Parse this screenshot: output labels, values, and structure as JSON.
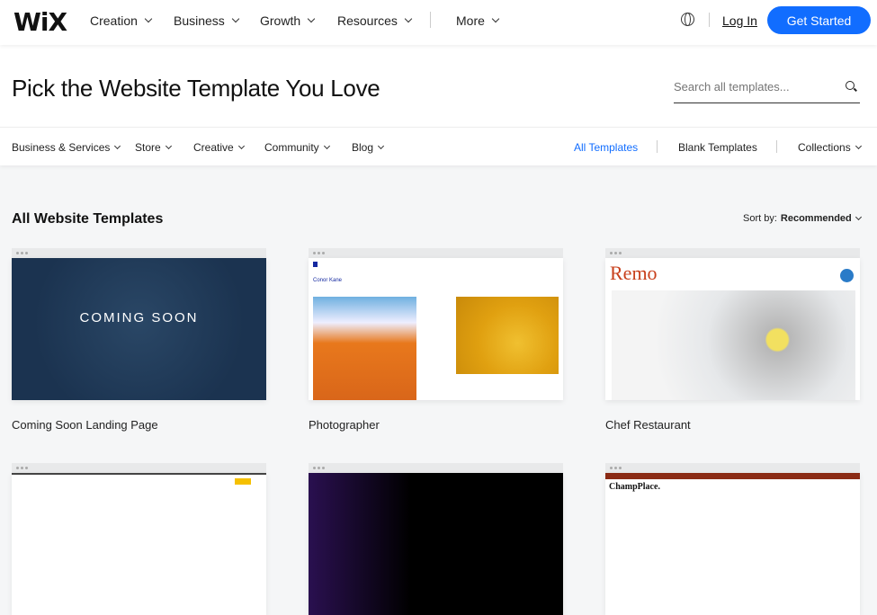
{
  "header": {
    "logo": "WiX",
    "nav": [
      "Creation",
      "Business",
      "Growth",
      "Resources",
      "More"
    ],
    "login": "Log In",
    "cta": "Get Started"
  },
  "hero": {
    "title": "Pick the Website Template You Love",
    "search_placeholder": "Search all templates..."
  },
  "categories": {
    "left": [
      "Business & Services",
      "Store",
      "Creative",
      "Community",
      "Blog"
    ],
    "right": [
      "All Templates",
      "Blank Templates",
      "Collections"
    ]
  },
  "main": {
    "section_title": "All Website Templates",
    "sort_label": "Sort by:",
    "sort_value": "Recommended",
    "templates": [
      {
        "name": "Coming Soon Landing Page",
        "preview_text": "COMING SOON"
      },
      {
        "name": "Photographer",
        "preview_text": "Conor Kane"
      },
      {
        "name": "Chef Restaurant",
        "preview_text": "Remo"
      }
    ],
    "next_row": [
      {
        "preview_text": ""
      },
      {
        "preview_text": ""
      },
      {
        "preview_text": "ChampPlace."
      }
    ]
  },
  "colors": {
    "accent": "#116dff",
    "bg": "#f5f6f7"
  }
}
